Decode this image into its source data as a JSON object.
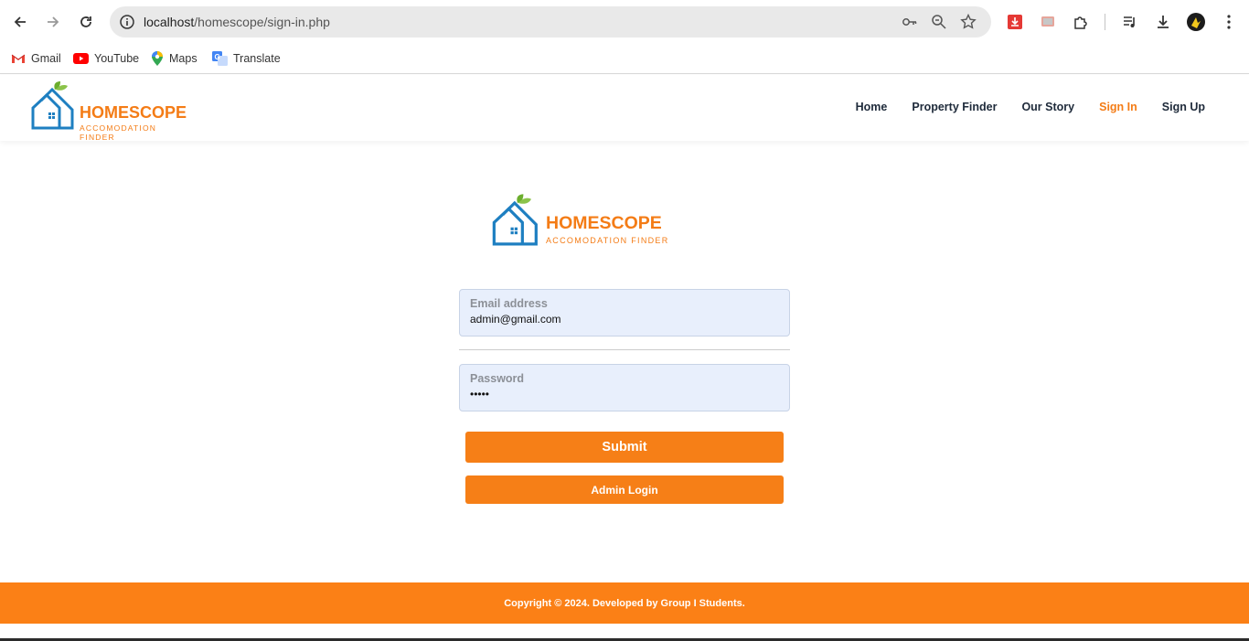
{
  "browser": {
    "url_host": "localhost",
    "url_path": "/homescope/sign-in.php",
    "bookmarks": [
      {
        "label": "Gmail",
        "icon": "gmail-icon"
      },
      {
        "label": "YouTube",
        "icon": "youtube-icon"
      },
      {
        "label": "Maps",
        "icon": "maps-icon"
      },
      {
        "label": "Translate",
        "icon": "translate-icon"
      }
    ]
  },
  "site": {
    "brand": "HOMESCOPE",
    "tagline": "ACCOMODATION FINDER",
    "nav": [
      {
        "label": "Home",
        "active": false
      },
      {
        "label": "Property Finder",
        "active": false
      },
      {
        "label": "Our Story",
        "active": false
      },
      {
        "label": "Sign In",
        "active": true
      },
      {
        "label": "Sign Up",
        "active": false
      }
    ],
    "accent_color": "#f47c16"
  },
  "form": {
    "email_label": "Email address",
    "email_value": "admin@gmail.com",
    "password_label": "Password",
    "password_value": "•••••",
    "submit_label": "Submit",
    "admin_label": "Admin Login"
  },
  "footer": {
    "text": "Copyright © 2024. Developed by Group I Students."
  }
}
